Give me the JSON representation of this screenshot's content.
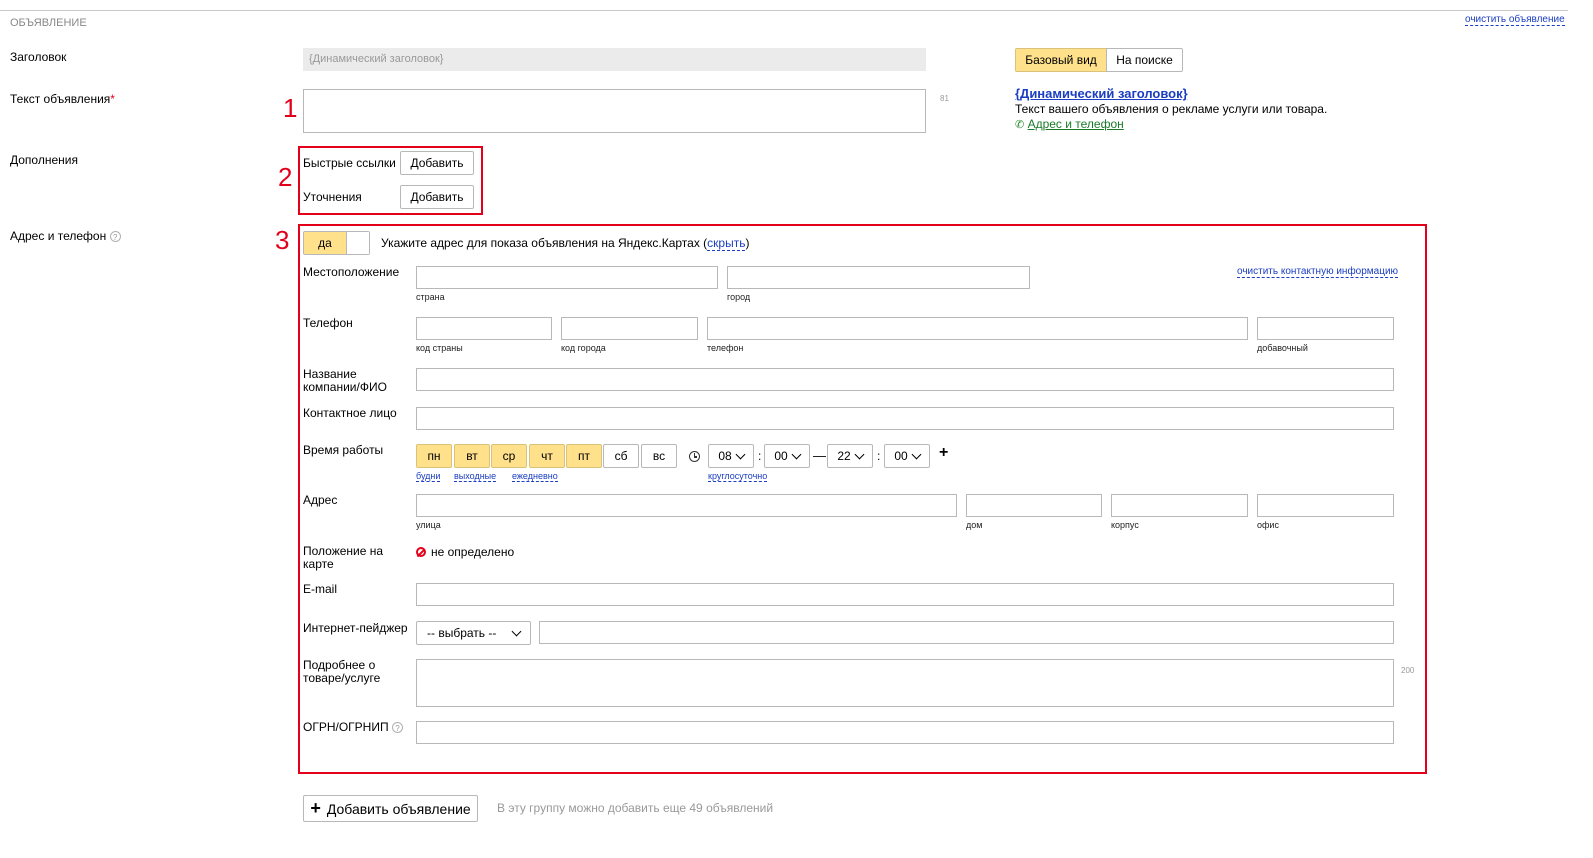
{
  "section": {
    "title": "ОБЪЯВЛЕНИЕ",
    "clear_ad": "очистить объявление"
  },
  "fields": {
    "headline_label": "Заголовок",
    "headline_value": "{Динамический заголовок}",
    "ad_text_label": "Текст объявления",
    "ad_text_required": "*",
    "ad_text_counter": "81",
    "extras_label": "Дополнения",
    "quick_links_label": "Быстрые ссылки",
    "quick_links_add": "Добавить",
    "clarifications_label": "Уточнения",
    "clarifications_add": "Добавить",
    "contact_label": "Адрес и телефон"
  },
  "preview": {
    "tab_basic": "Базовый вид",
    "tab_search": "На поиске",
    "title": "{Динамический заголовок}",
    "text": "Текст вашего объявления о рекламе услуги или товара.",
    "contact_link": "Адрес и телефон"
  },
  "contact": {
    "toggle_yes": "да",
    "map_hint": "Укажите адрес для показа объявления на Яндекс.Картах",
    "hide_link": "скрыть",
    "clear_contact": "очистить контактную информацию",
    "location_label": "Местоположение",
    "country_sub": "страна",
    "city_sub": "город",
    "phone_label": "Телефон",
    "country_code_sub": "код страны",
    "city_code_sub": "код города",
    "phone_sub": "телефон",
    "ext_sub": "добавочный",
    "company_label": "Название компании/ФИО",
    "contact_person_label": "Контактное лицо",
    "work_time_label": "Время работы",
    "days": [
      "пн",
      "вт",
      "ср",
      "чт",
      "пт",
      "сб",
      "вс"
    ],
    "days_selected": [
      true,
      true,
      true,
      true,
      true,
      false,
      false
    ],
    "weekdays_link": "будни",
    "weekends_link": "выходные",
    "daily_link": "ежедневно",
    "from_hour": "08",
    "from_min": "00",
    "to_hour": "22",
    "to_min": "00",
    "time_sep": ":",
    "dash": "—",
    "plus": "+",
    "around_clock_link": "круглосуточно",
    "address_label": "Адрес",
    "street_sub": "улица",
    "house_sub": "дом",
    "building_sub": "корпус",
    "office_sub": "офис",
    "map_pos_label": "Положение на карте",
    "map_pos_value": "не определено",
    "email_label": "E-mail",
    "pager_label": "Интернет-пейджер",
    "pager_select": "-- выбрать --",
    "details_label": "Подробнее о товаре/услуге",
    "details_counter": "200",
    "ogrn_label": "ОГРН/ОГРНИП"
  },
  "footer": {
    "add_ad": "Добавить объявление",
    "add_ad_plus": "+",
    "hint": "В эту группу можно добавить еще 49 объявлений"
  },
  "annotations": {
    "n1": "1",
    "n2": "2",
    "n3": "3"
  },
  "colors": {
    "accent": "#ffe18c",
    "annotation": "#e3001b",
    "link": "#1a3dc1"
  }
}
